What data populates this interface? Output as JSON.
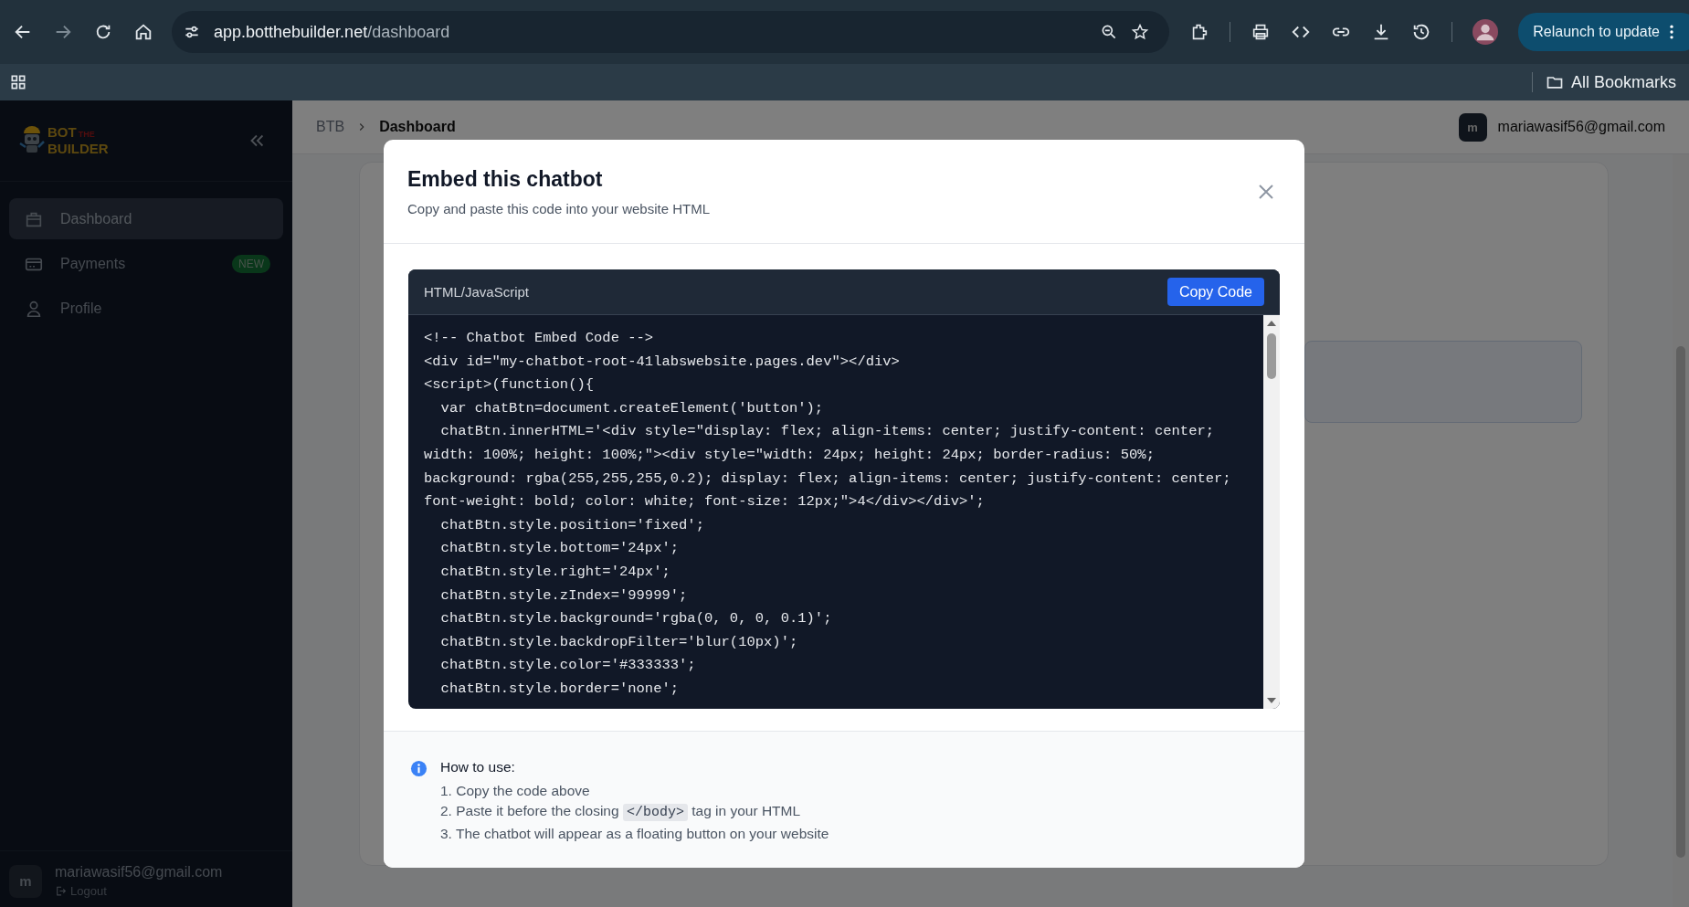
{
  "browser": {
    "url_host": "app.botthebuilder.net",
    "url_path": "/dashboard",
    "relaunch_button": "Relaunch to update",
    "bookmarks_folder": "All Bookmarks"
  },
  "sidebar": {
    "logo": {
      "top": "BOT",
      "small": "THE",
      "bottom": "BUILDER"
    },
    "items": [
      {
        "kind": "dashboard",
        "label": "Dashboard",
        "selected": true
      },
      {
        "kind": "payments",
        "label": "Payments",
        "selected": false,
        "badge": "NEW"
      },
      {
        "kind": "profile",
        "label": "Profile",
        "selected": false
      }
    ],
    "user": {
      "avatar": "m",
      "email": "mariawasif56@gmail.com",
      "logout": "Logout"
    }
  },
  "header": {
    "breadcrumb": [
      "BTB",
      "Dashboard"
    ],
    "user": {
      "avatar": "m",
      "email": "mariawasif56@gmail.com"
    }
  },
  "modal": {
    "title": "Embed this chatbot",
    "subtitle": "Copy and paste this code into your website HTML",
    "code": {
      "language": "HTML/JavaScript",
      "copy_button": "Copy Code",
      "lines": [
        "<!-- Chatbot Embed Code -->",
        "<div id=\"my-chatbot-root-41labswebsite.pages.dev\"></div>",
        "<script>(function(){",
        "  var chatBtn=document.createElement('button');",
        "  chatBtn.innerHTML='<div style=\"display: flex; align-items: center; justify-content: center;",
        "width: 100%; height: 100%;\"><div style=\"width: 24px; height: 24px; border-radius: 50%;",
        "background: rgba(255,255,255,0.2); display: flex; align-items: center; justify-content: center;",
        "font-weight: bold; color: white; font-size: 12px;\">4</div></div>';",
        "  chatBtn.style.position='fixed';",
        "  chatBtn.style.bottom='24px';",
        "  chatBtn.style.right='24px';",
        "  chatBtn.style.zIndex='99999';",
        "  chatBtn.style.background='rgba(0, 0, 0, 0.1)';",
        "  chatBtn.style.backdropFilter='blur(10px)';",
        "  chatBtn.style.color='#333333';",
        "  chatBtn.style.border='none';"
      ]
    },
    "instructions": {
      "title": "How to use:",
      "steps": [
        {
          "text": "1. Copy the code above"
        },
        {
          "text": "2. Paste it before the closing ",
          "code": "</body>",
          "after": " tag in your HTML"
        },
        {
          "text": "3. The chatbot will appear as a floating button on your website"
        }
      ]
    }
  }
}
